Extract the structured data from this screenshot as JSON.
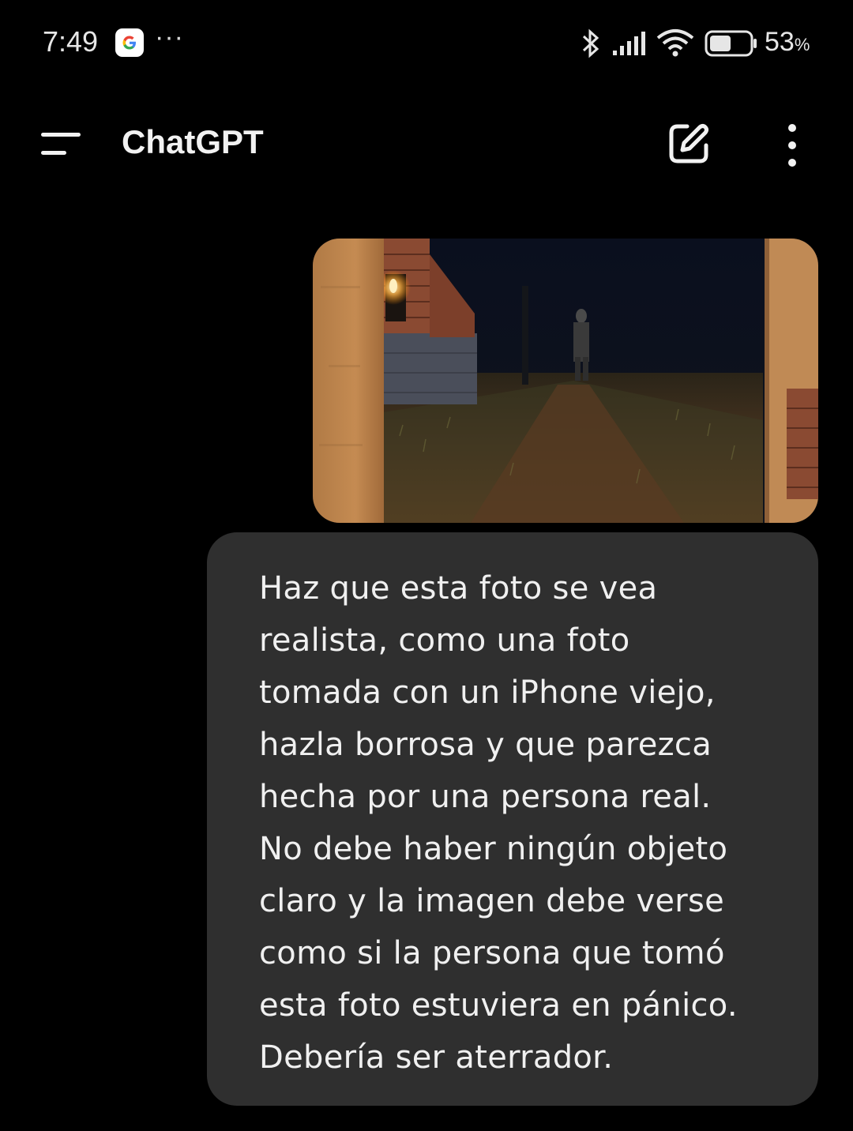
{
  "status_bar": {
    "time": "7:49",
    "google_icon": "google-g-icon",
    "more_dots": "···",
    "battery_percent": "53",
    "battery_unit": "%"
  },
  "app_bar": {
    "title": "ChatGPT",
    "menu_icon": "hamburger-menu-icon",
    "new_chat_icon": "new-chat-edit-icon",
    "more_icon": "vertical-dots-icon"
  },
  "message": {
    "image_alt": "",
    "text_lines": [
      "Haz que esta foto se vea",
      "realista, como una foto",
      "tomada con un iPhone viejo,",
      "hazla borrosa y que parezca",
      "hecha por una persona real.",
      "No debe haber ningún objeto",
      "claro y la imagen debe verse",
      "como si la persona que tomó",
      "esta foto estuviera en pánico.",
      "Debería ser aterrador."
    ]
  },
  "colors": {
    "background": "#000000",
    "bubble": "#2f2f2f",
    "text": "#f0f0f0"
  }
}
